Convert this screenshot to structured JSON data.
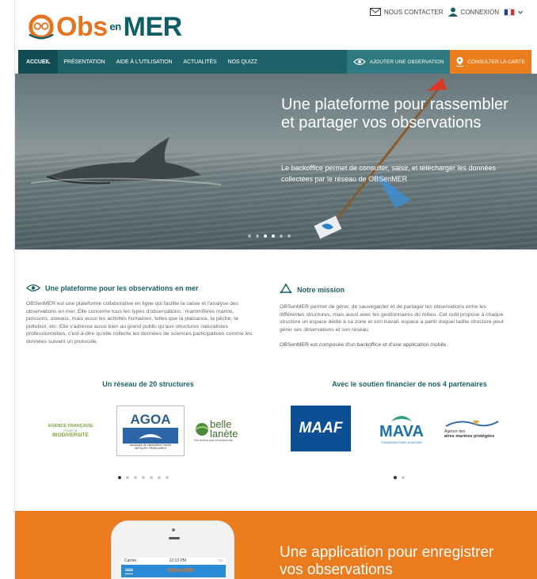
{
  "header": {
    "logo": {
      "part1": "Obs",
      "part2": "en",
      "part3": "MER"
    },
    "contact_label": "NOUS CONTACTER",
    "login_label": "CONNEXION",
    "flag_colors": [
      "#1f3d99",
      "#ffffff",
      "#e3262f"
    ]
  },
  "nav": {
    "items": [
      {
        "label": "ACCUEIL"
      },
      {
        "label": "PRÉSENTATION"
      },
      {
        "label": "AIDE À L'UTILISATION"
      },
      {
        "label": "ACTUALITÉS"
      },
      {
        "label": "NOS QUIZZ"
      }
    ],
    "add_label": "AJOUTER UNE OBSERVATION",
    "map_label": "CONSULTER LA CARTE"
  },
  "hero": {
    "title": "Une plateforme pour rassembler et partager vos observations",
    "text": "Le backoffice permet de consulter, saisir, et télécharger les données collectées par le réseau de OBSenMER",
    "slide_count": 6,
    "active_slide": 3
  },
  "platform": {
    "title": "Une plateforme pour les observations en mer",
    "text": "OBSenMER est une plateforme collaborative en ligne qui facilite la saisie et l'analyse des observations en mer. Elle concerne tous les types d'observations : mammifères marins, poissons, oiseaux, mais aussi les activités humaines, telles que la plaisance, la pêche, la pollution, etc. Elle s'adresse aussi bien au grand public qu'aux structures naturalistes professionnelles, c'est-à-dire qu'elle collecte les données de sciences participatives comme les données suivant un protocole."
  },
  "mission": {
    "title": "Notre mission",
    "text": "OBSenMER permet de gérer, de sauvegarder et de partager les observations entre les différentes structures, mais aussi avec les gestionnaires du milieu. Cet outil propose à chaque structure un espace dédié à sa zone et son travail, espace à partir duquel ladite structure peut gérer ses observations et son réseau.",
    "text2": "OBSenMER est composée d'un backoffice et d'une application mobile."
  },
  "network": {
    "title": "Un réseau de 20 structures",
    "logos": [
      {
        "line1": "AGENCE FRANÇAISE",
        "line2": "POUR LA",
        "line3": "BIODIVERSITÉ"
      },
      {
        "name": "AGOA",
        "caption": "sanctuaire de mammifères marins",
        "caption2": "ANTILLES FRANÇAISES"
      },
      {
        "name1": "belle",
        "name2": "lanète",
        "caption": "Des actions pour la biodiversité"
      }
    ],
    "dot_count": 7,
    "active_dot": 1
  },
  "partners": {
    "title": "Avec le soutien financier de nos 4 partenaires",
    "logos": [
      {
        "name": "MAAF"
      },
      {
        "name": "MAVA",
        "caption": "FONDATION POUR LA NATURE"
      },
      {
        "line1": "Agence des",
        "line2": "aires marines protégées"
      }
    ],
    "dot_count": 2,
    "active_dot": 1
  },
  "app_section": {
    "title": "Une application pour enregistrer vos observations",
    "phone": {
      "carrier": "Carrier",
      "time": "12:13 PM",
      "app_name": "OBSenMER"
    }
  },
  "colors": {
    "teal": "#1d6268",
    "orange": "#ea7b1e",
    "light_teal": "#2f7a80"
  }
}
